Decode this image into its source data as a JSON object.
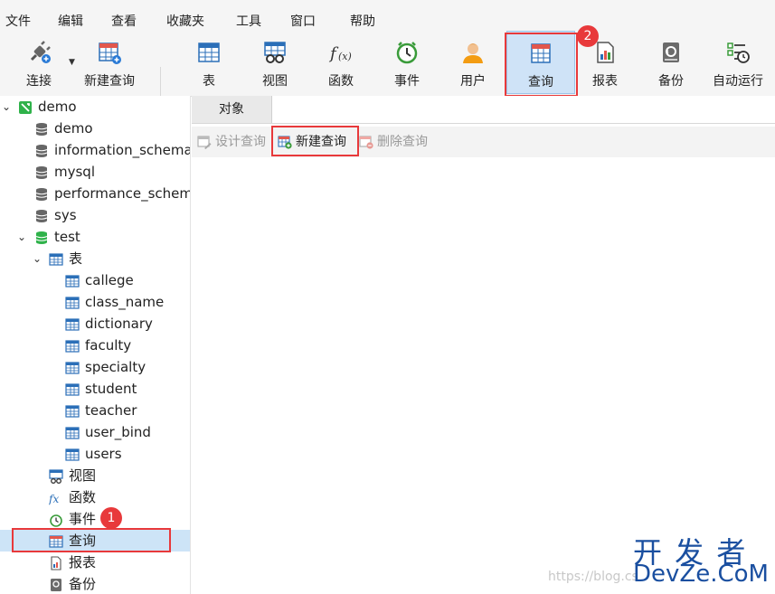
{
  "menu": [
    "文件",
    "编辑",
    "查看",
    "收藏夹",
    "工具",
    "窗口",
    "帮助"
  ],
  "toolbar": {
    "connect": "连接",
    "new_query": "新建查询",
    "table": "表",
    "view": "视图",
    "function": "函数",
    "event": "事件",
    "user": "用户",
    "query": "查询",
    "report": "报表",
    "backup": "备份",
    "automation": "自动运行"
  },
  "badges": {
    "one": "1",
    "two": "2"
  },
  "tree": {
    "root": "demo",
    "databases": [
      "demo",
      "information_schema",
      "mysql",
      "performance_schema",
      "sys"
    ],
    "open_db": "test",
    "tables_node": "表",
    "tables": [
      "callege",
      "class_name",
      "dictionary",
      "faculty",
      "specialty",
      "student",
      "teacher",
      "user_bind",
      "users"
    ],
    "objects": [
      "视图",
      "函数",
      "事件",
      "查询",
      "报表",
      "备份"
    ]
  },
  "tab": {
    "objects": "对象"
  },
  "object_toolbar": {
    "design": "设计查询",
    "new": "新建查询",
    "delete": "删除查询"
  },
  "watermark": {
    "brand_cn": "开 发 者",
    "brand_en": "DevZe.CoM",
    "url": "https://blog.cs"
  },
  "colors": {
    "accent_red": "#e8393b",
    "active_bg": "#cfe3f7",
    "tree_green": "#2fb24a"
  }
}
